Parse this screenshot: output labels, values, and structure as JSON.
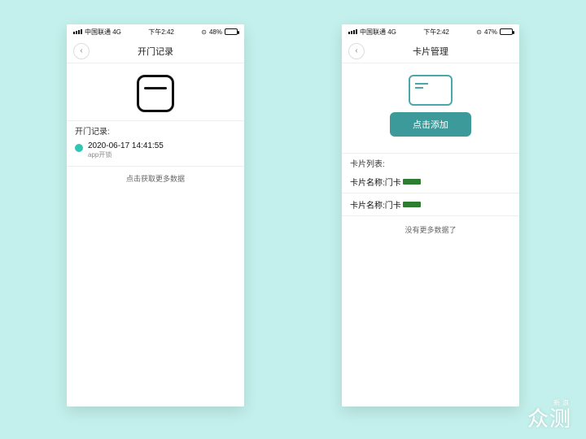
{
  "statusbar": {
    "carrier": "中国联通 4G",
    "time": "下午2:42"
  },
  "left": {
    "battery": "48%",
    "title": "开门记录",
    "section_label": "开门记录:",
    "record_time": "2020-06-17 14:41:55",
    "record_sub": "app开锁",
    "more": "点击获取更多数据"
  },
  "right": {
    "battery": "47%",
    "title": "卡片管理",
    "add_label": "点击添加",
    "list_label": "卡片列表:",
    "item_prefix": "卡片名称:门卡",
    "nomore": "没有更多数据了"
  },
  "watermark": {
    "small": "新浪",
    "big": "众测"
  }
}
